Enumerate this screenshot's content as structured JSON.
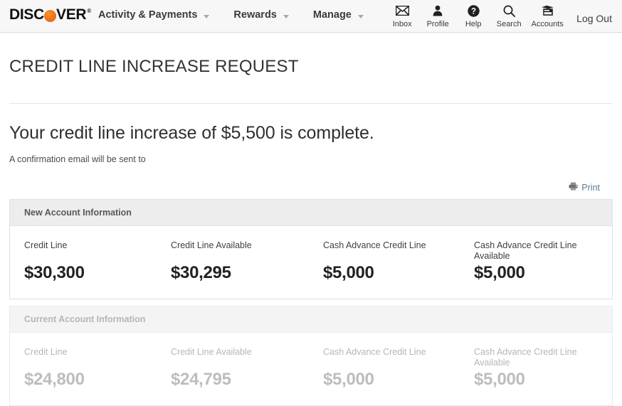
{
  "header": {
    "logo": {
      "text_before": "DISC",
      "text_after": "VER",
      "registered_mark": "®",
      "dot_color": "#ef7622"
    },
    "menu": [
      {
        "label": "Activity & Payments",
        "icon": "chevron-down-icon"
      },
      {
        "label": "Rewards",
        "icon": "chevron-down-icon"
      },
      {
        "label": "Manage",
        "icon": "chevron-down-icon"
      }
    ],
    "utilities": [
      {
        "label": "Inbox",
        "icon": "envelope-icon"
      },
      {
        "label": "Profile",
        "icon": "person-icon"
      },
      {
        "label": "Help",
        "icon": "question-circle-icon"
      },
      {
        "label": "Search",
        "icon": "search-icon"
      },
      {
        "label": "Accounts",
        "icon": "accounts-card-icon"
      }
    ],
    "logout_label": "Log Out"
  },
  "page": {
    "title": "CREDIT LINE INCREASE REQUEST",
    "headline": "Your credit line increase of $5,500 is complete.",
    "subline": "A confirmation email will be sent to",
    "print_label": "Print",
    "print_icon": "printer-icon"
  },
  "panels": [
    {
      "heading": "New Account Information",
      "state": "active",
      "cells": [
        {
          "label": "Credit Line",
          "value": "$30,300"
        },
        {
          "label": "Credit Line Available",
          "value": "$30,295"
        },
        {
          "label": "Cash Advance Credit Line",
          "value": "$5,000"
        },
        {
          "label": "Cash Advance Credit Line Available",
          "value": "$5,000"
        }
      ]
    },
    {
      "heading": "Current Account Information",
      "state": "faded",
      "cells": [
        {
          "label": "Credit Line",
          "value": "$24,800"
        },
        {
          "label": "Credit Line Available",
          "value": "$24,795"
        },
        {
          "label": "Cash Advance Credit Line",
          "value": "$5,000"
        },
        {
          "label": "Cash Advance Credit Line Available",
          "value": "$5,000"
        }
      ]
    }
  ],
  "colors": {
    "brand_orange": "#ef7622",
    "nav_background": "#f7f7f7",
    "panel_header": "#ededed",
    "link_blue": "#5d7a8c",
    "text_dark": "#333333",
    "text_faded": "#b6b6b6"
  }
}
